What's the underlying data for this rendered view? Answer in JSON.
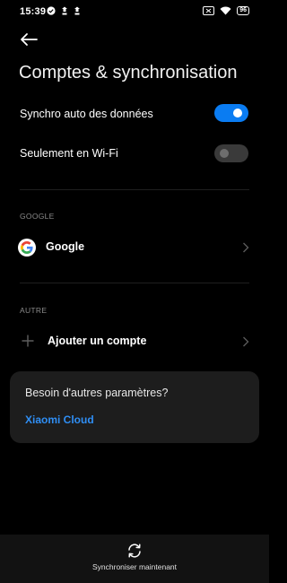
{
  "status_bar": {
    "time": "15:39",
    "battery": "96"
  },
  "header": {
    "title": "Comptes & synchronisation"
  },
  "settings": {
    "auto_sync": {
      "label": "Synchro auto des données",
      "enabled": true
    },
    "wifi_only": {
      "label": "Seulement en Wi-Fi",
      "enabled": false
    }
  },
  "sections": {
    "google": {
      "header": "GOOGLE",
      "account_label": "Google"
    },
    "other": {
      "header": "AUTRE",
      "add_label": "Ajouter un compte"
    }
  },
  "card": {
    "title": "Besoin d'autres paramètres?",
    "link": "Xiaomi Cloud"
  },
  "bottom": {
    "sync_label": "Synchroniser maintenant"
  },
  "colors": {
    "accent": "#0a7cf2",
    "link": "#2f8ef4",
    "background": "#000000",
    "card": "#1d1d1d"
  }
}
